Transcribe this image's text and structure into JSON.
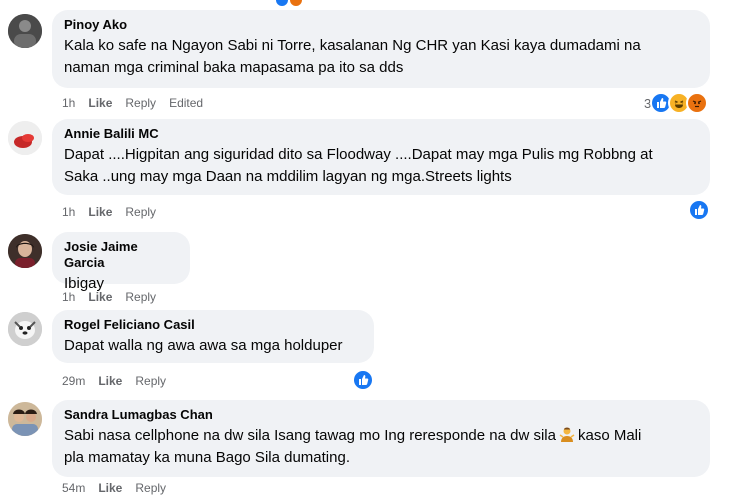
{
  "comments": [
    {
      "author": "Pinoy Ako",
      "text_line1": "Kala ko safe na Ngayon Sabi ni Torre, kasalanan Ng CHR yan Kasi kaya dumadami na",
      "text_line2": "naman mga criminal baka mapasama pa ito sa dds",
      "time": "1h",
      "like": "Like",
      "reply": "Reply",
      "edited": "Edited",
      "reaction_count": "3",
      "reactions": [
        "like-icon",
        "haha-icon",
        "angry-icon"
      ]
    },
    {
      "author": "Annie Balili MC",
      "text_line1": "Dapat ....Higpitan ang siguridad dito sa Floodway ....Dapat may mga Pulis mg Robbng at",
      "text_line2": "Saka ..ung may mga Daan na mddilim lagyan ng mga.Streets lights",
      "time": "1h",
      "like": "Like",
      "reply": "Reply",
      "reactions": [
        "like-icon"
      ]
    },
    {
      "author": "Josie Jaime Garcia",
      "text_line1": "Ibigay",
      "time": "1h",
      "like": "Like",
      "reply": "Reply"
    },
    {
      "author": "Rogel Feliciano Casil",
      "text_line1": "Dapat walla ng awa awa sa mga holduper",
      "time": "29m",
      "like": "Like",
      "reply": "Reply",
      "reactions": [
        "like-icon"
      ]
    },
    {
      "author": "Sandra Lumagbas Chan",
      "text_line1_a": "Sabi nasa cellphone na dw sila Isang tawag mo Ing reresponde na dw sila",
      "text_line1_b": "kaso Mali",
      "text_line2": "pla mamatay ka muna Bago Sila dumating.",
      "inline_emoji": "person-shrugging-emoji",
      "time": "54m",
      "like": "Like",
      "reply": "Reply"
    }
  ],
  "colors": {
    "bubble": "#f0f2f5",
    "meta": "#65676b",
    "like_blue": "#1877f2",
    "haha_yellow": "#f7b125",
    "angry_orange": "#e9710f"
  }
}
